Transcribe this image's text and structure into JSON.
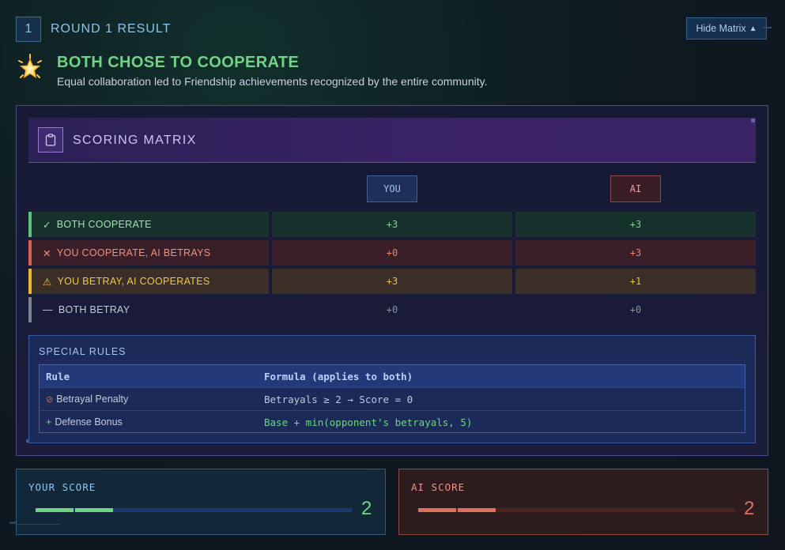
{
  "header": {
    "round_number": "1",
    "round_title": "ROUND 1 RESULT",
    "hide_matrix_label": "Hide Matrix",
    "hide_matrix_arrow": "▲"
  },
  "result": {
    "icon": "glowing-star-icon",
    "title": "BOTH CHOSE TO COOPERATE",
    "description": "Equal collaboration led to Friendship achievements recognized by the entire community."
  },
  "matrix": {
    "title": "SCORING MATRIX",
    "icon": "clipboard-icon",
    "columns": [
      "YOU",
      "AI"
    ],
    "rows": [
      {
        "symbol": "✓",
        "label": "BOTH COOPERATE",
        "you": "+3",
        "ai": "+3"
      },
      {
        "symbol": "✕",
        "label": "YOU COOPERATE, AI BETRAYS",
        "you": "+0",
        "ai": "+3"
      },
      {
        "symbol": "⚠",
        "label": "YOU BETRAY, AI COOPERATES",
        "you": "+3",
        "ai": "+1"
      },
      {
        "symbol": "—",
        "label": "BOTH BETRAY",
        "you": "+0",
        "ai": "+0"
      }
    ]
  },
  "special_rules": {
    "title": "SPECIAL RULES",
    "headers": [
      "Rule",
      "Formula (applies to both)"
    ],
    "rows": [
      {
        "symbol": "⊘",
        "rule": "Betrayal Penalty",
        "formula": "Betrayals ≥ 2 → Score = 0"
      },
      {
        "symbol": "+",
        "rule": "Defense Bonus",
        "formula": "Base + min(opponent's betrayals, 5)"
      }
    ]
  },
  "scores": {
    "you": {
      "label": "YOUR SCORE",
      "value": "2",
      "segments_filled": 2,
      "segments_total": 8,
      "color": "#6fd484"
    },
    "ai": {
      "label": "AI SCORE",
      "value": "2",
      "segments_filled": 2,
      "segments_total": 8,
      "color": "#e0705e"
    }
  },
  "colors": {
    "cooperate": "#5cc07a",
    "betrayed": "#d8604e",
    "betray": "#e8b830",
    "neutral": "#7c8494",
    "accent": "#8fc4ea"
  }
}
